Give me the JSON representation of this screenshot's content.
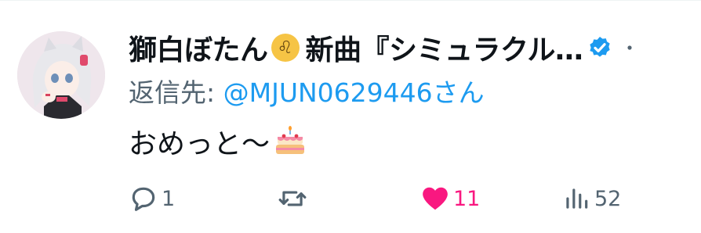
{
  "tweet": {
    "author_name": "獅白ぼたん",
    "author_name_rest": "新曲『シミュラクル…",
    "leo_symbol": "♌",
    "reply_prefix": "返信先:",
    "reply_handle": "@MJUN0629446",
    "reply_suffix": "さん",
    "text": "おめっと～"
  },
  "actions": {
    "replies": "1",
    "retweets": "",
    "likes": "11",
    "views": "52"
  },
  "colors": {
    "link": "#1d9bf0",
    "like": "#f91880",
    "muted": "#536471",
    "verified": "#1d9bf0"
  },
  "icons": [
    "verified-badge-icon",
    "more-icon",
    "cake-emoji-icon",
    "reply-icon",
    "retweet-icon",
    "heart-icon",
    "views-icon"
  ]
}
